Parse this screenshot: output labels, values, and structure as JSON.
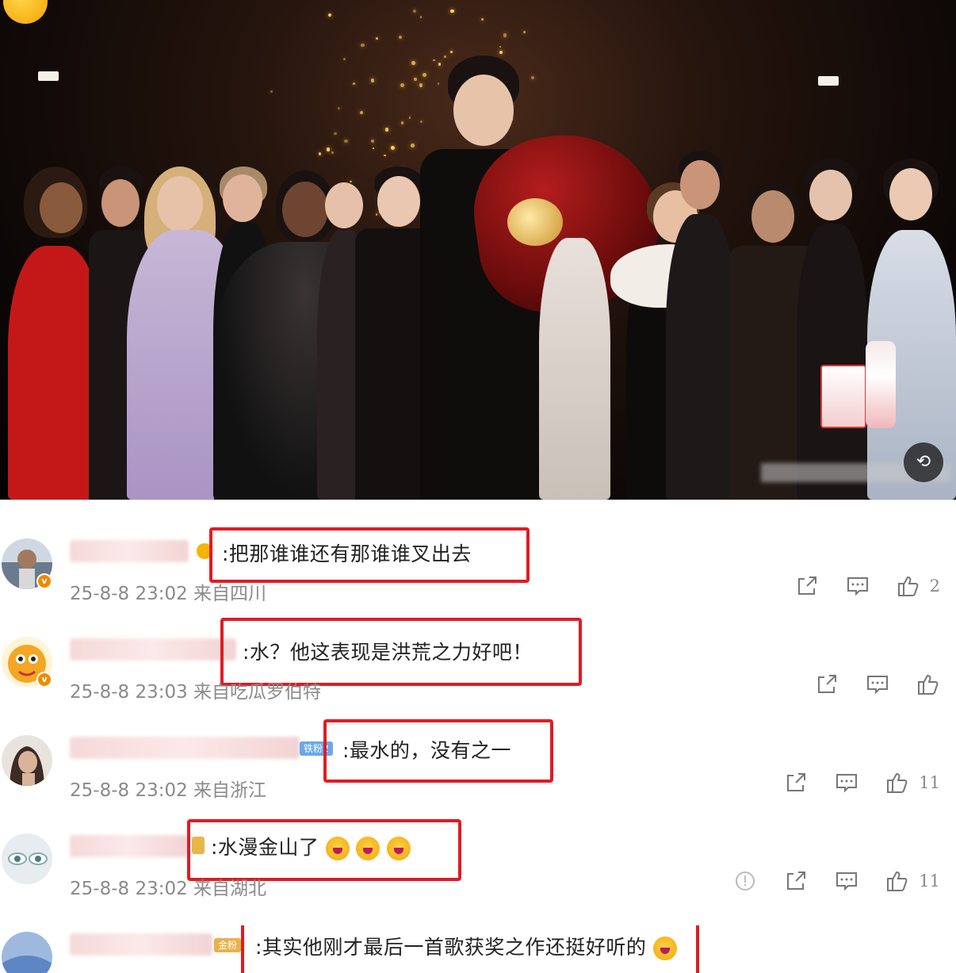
{
  "comments": [
    {
      "text": ":把那谁谁还有那谁谁叉出去",
      "timestamp": "25-8-8 23:02",
      "location": "来自四川",
      "likes": "2",
      "avatar_color": "#6b7a8c"
    },
    {
      "text": ":水？他这表现是洪荒之力好吧！",
      "timestamp": "25-8-8 23:03",
      "location": "来自吃瓜罗伯特",
      "likes": "",
      "avatar_color": "#f5a623"
    },
    {
      "text": ":最水的，没有之一",
      "timestamp": "25-8-8 23:02",
      "location": "来自浙江",
      "likes": "11",
      "badge": "铁粉2",
      "avatar_color": "#3d2b26"
    },
    {
      "text": ":水漫金山了",
      "timestamp": "25-8-8 23:02",
      "location": "来自湖北",
      "likes": "11",
      "avatar_color": "#c8d6dc"
    },
    {
      "text": ":其实他刚才最后一首歌获奖之作还挺好听的",
      "badge": "金粉",
      "avatar_color": "#5c86c4"
    }
  ],
  "colors": {
    "highlight_box": "#e11b23",
    "meta_gray": "#8a8a8a",
    "verified_badge": "#f08a00"
  },
  "icons": {
    "share": "share-icon",
    "comment": "comment-icon",
    "like": "thumbs-up-icon",
    "report": "report-icon",
    "video_control": "video-control-icon"
  }
}
